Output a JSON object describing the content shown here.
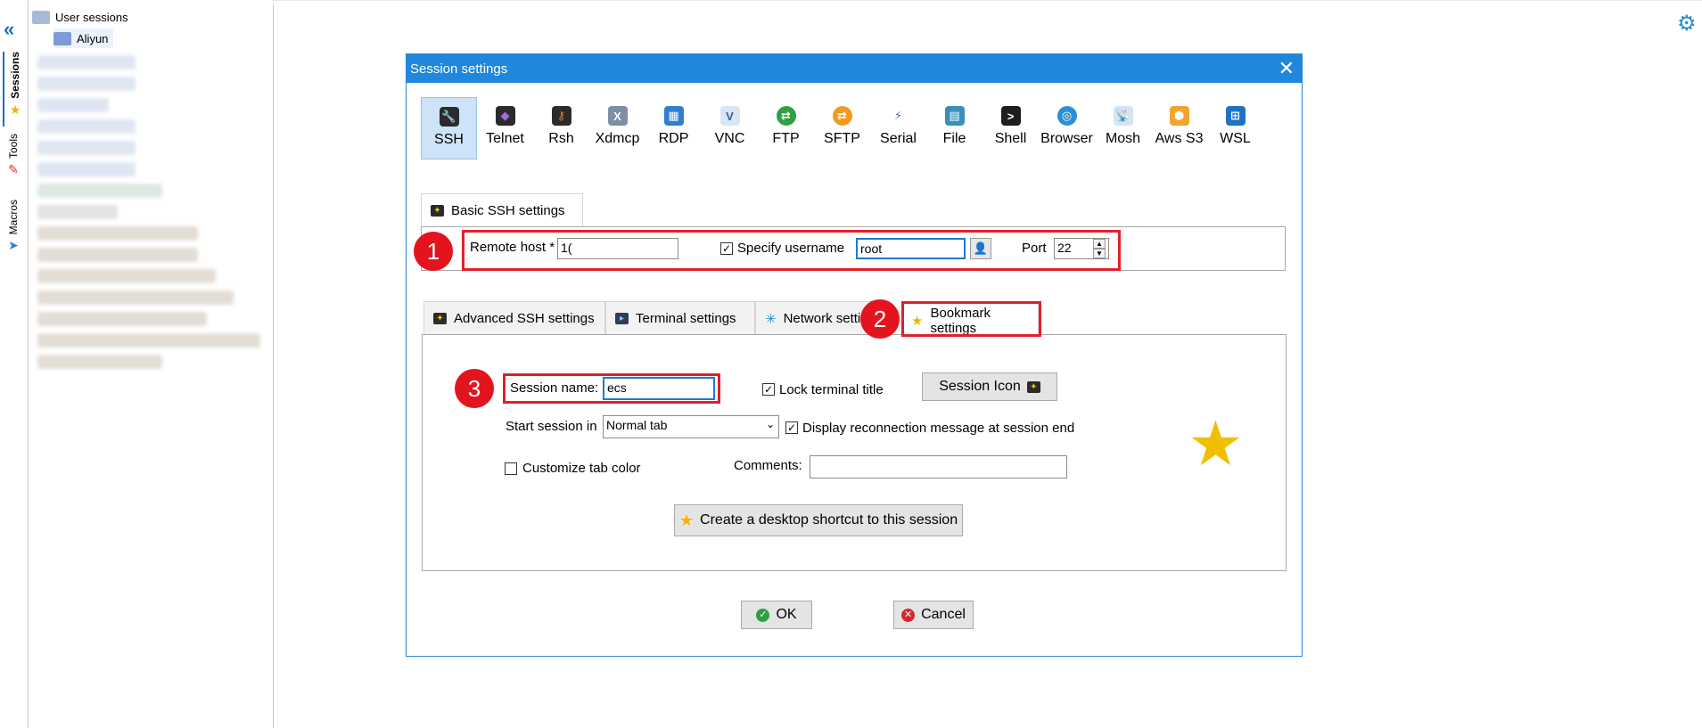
{
  "sidebar": {
    "tabs": [
      {
        "label": "Sessions",
        "icon": "sessions-icon"
      },
      {
        "label": "Tools",
        "icon": "tools-icon"
      },
      {
        "label": "Macros",
        "icon": "macros-icon"
      }
    ]
  },
  "tree": {
    "root_label": "User sessions",
    "folder_label": "Aliyun"
  },
  "dialog": {
    "title": "Session settings",
    "protocols": [
      "SSH",
      "Telnet",
      "Rsh",
      "Xdmcp",
      "RDP",
      "VNC",
      "FTP",
      "SFTP",
      "Serial",
      "File",
      "Shell",
      "Browser",
      "Mosh",
      "Aws S3",
      "WSL"
    ],
    "active_protocol": "SSH",
    "basic_tab": "Basic SSH settings",
    "remote_host_label": "Remote host *",
    "remote_host_value": "1(",
    "specify_username_label": "Specify username",
    "username_value": "root",
    "port_label": "Port",
    "port_value": "22",
    "tabs": [
      "Advanced SSH settings",
      "Terminal settings",
      "Network setti",
      "Bookmark settings"
    ],
    "session_name_label": "Session name:",
    "session_name_value": "ecs",
    "lock_terminal_label": "Lock terminal title",
    "session_icon_button": "Session Icon",
    "start_session_label": "Start session in",
    "start_session_value": "Normal tab",
    "display_reconnect_label": "Display reconnection message at session end",
    "customize_tab_label": "Customize tab color",
    "comments_label": "Comments:",
    "comments_value": "",
    "shortcut_button": "Create a desktop shortcut to this session",
    "ok_button": "OK",
    "cancel_button": "Cancel"
  },
  "annotations": [
    "1",
    "2",
    "3"
  ],
  "colors": {
    "accent": "#1f88dd",
    "highlight_box": "#e0202a",
    "star": "#f0c000"
  }
}
